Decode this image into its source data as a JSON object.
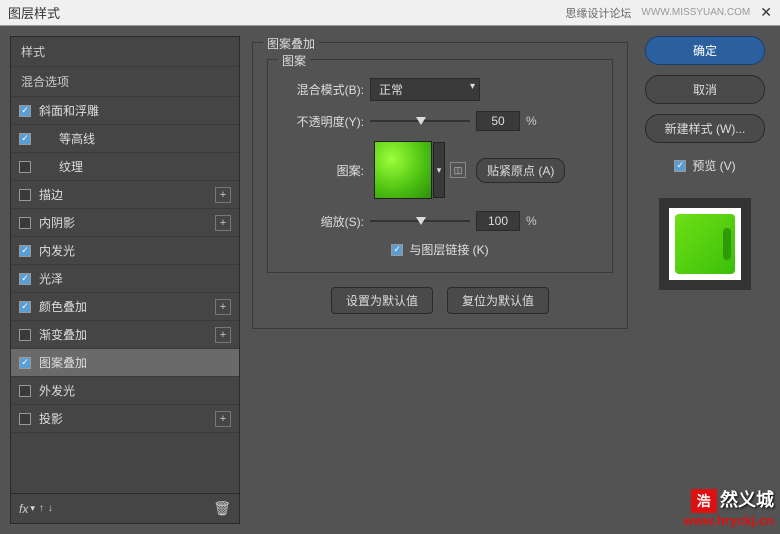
{
  "titlebar": {
    "title": "图层样式",
    "forum": "思缘设计论坛",
    "url": "WWW.MISSYUAN.COM"
  },
  "sidebar": {
    "header1": "样式",
    "header2": "混合选项",
    "items": [
      {
        "label": "斜面和浮雕",
        "checked": true,
        "add": false,
        "indent": false
      },
      {
        "label": "等高线",
        "checked": true,
        "add": false,
        "indent": true
      },
      {
        "label": "纹理",
        "checked": false,
        "add": false,
        "indent": true
      },
      {
        "label": "描边",
        "checked": false,
        "add": true,
        "indent": false
      },
      {
        "label": "内阴影",
        "checked": false,
        "add": true,
        "indent": false
      },
      {
        "label": "内发光",
        "checked": true,
        "add": false,
        "indent": false
      },
      {
        "label": "光泽",
        "checked": true,
        "add": false,
        "indent": false
      },
      {
        "label": "颜色叠加",
        "checked": true,
        "add": true,
        "indent": false
      },
      {
        "label": "渐变叠加",
        "checked": false,
        "add": true,
        "indent": false
      },
      {
        "label": "图案叠加",
        "checked": true,
        "add": false,
        "indent": false,
        "selected": true
      },
      {
        "label": "外发光",
        "checked": false,
        "add": false,
        "indent": false
      },
      {
        "label": "投影",
        "checked": false,
        "add": true,
        "indent": false
      }
    ],
    "footer": {
      "fx": "fx"
    }
  },
  "main": {
    "group_label": "图案叠加",
    "inner_label": "图案",
    "blend_label": "混合模式(B):",
    "blend_value": "正常",
    "opacity_label": "不透明度(Y):",
    "opacity_value": "50",
    "pct": "%",
    "pattern_label": "图案:",
    "snap_label": "贴紧原点 (A)",
    "scale_label": "缩放(S):",
    "scale_value": "100",
    "link_label": "与图层链接 (K)",
    "btn_default": "设置为默认值",
    "btn_reset": "复位为默认值"
  },
  "right": {
    "ok": "确定",
    "cancel": "取消",
    "newstyle": "新建样式 (W)...",
    "preview": "预览 (V)"
  },
  "watermark": {
    "logo": "浩",
    "chars": "然义城",
    "url": "www.hryckj.cn"
  }
}
